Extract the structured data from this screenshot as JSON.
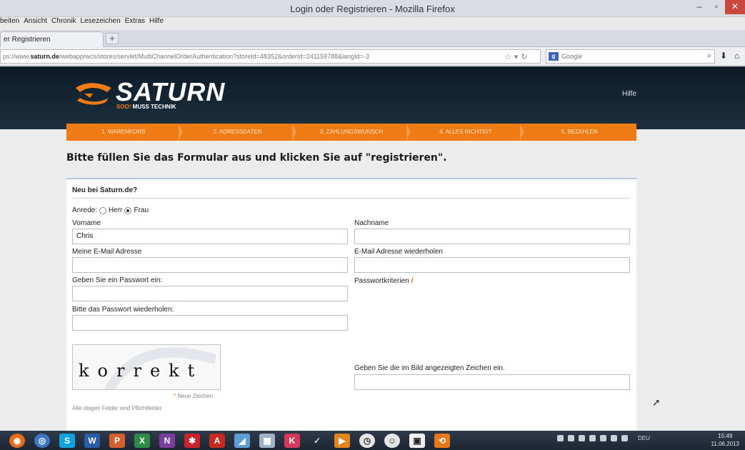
{
  "window": {
    "title": "Login oder Registrieren - Mozilla Firefox",
    "menu": [
      "beiten",
      "Ansicht",
      "Chronik",
      "Lesezeichen",
      "Extras",
      "Hilfe"
    ],
    "tab_label": "er Registrieren",
    "new_tab_symbol": "+"
  },
  "navbar": {
    "url_prefix": "ps://www.",
    "url_domain": "saturn.de",
    "url_rest": "/webapp/wcs/stores/servlet/MultiChannelOrderAuthentication?storeId=48352&orderId=241159788&langId=-3",
    "search_placeholder": "Google",
    "search_engine_icon": "g-icon"
  },
  "site": {
    "logo_text": "SATURN",
    "logo_tag_orange": "SOO!",
    "logo_tag_white": " MUSS TECHNIK",
    "help": "Hilfe",
    "steps": [
      "1. Warenkorb",
      "2. Adressdaten",
      "3. Zahlungswunsch",
      "4. Alles richtig?",
      "5. Bezahlen"
    ],
    "headline": "Bitte füllen Sie das Formular aus und klicken Sie auf \"registrieren\"."
  },
  "form": {
    "section_title": "Neu bei Saturn.de?",
    "salutation_label": "Anrede:",
    "salutation_options": [
      "Herr",
      "Frau"
    ],
    "salutation_selected": "Frau",
    "vorname_label": "Vorname",
    "vorname_value": "Chris",
    "nachname_label": "Nachname",
    "nachname_value": "",
    "email_label": "Meine E-Mail Adresse",
    "email_repeat_label": "E-Mail Adresse wiederholen",
    "password_label": "Geben Sie ein Passwort ein:",
    "password_criteria_label": "Passwortkriterien",
    "password_repeat_label": "Bitte das Passwort wiederholen:",
    "captcha_text": "korrekt",
    "captcha_instruction": "Geben Sie die im Bild angezeigten Zeichen ein.",
    "captcha_new": "Neue Zeichen",
    "required_note": "Alle obigen Felder sind Pflichtfelder."
  },
  "taskbar": {
    "tray_lang": "DEU",
    "clock_time": "15:49",
    "clock_date": "11.06.2013"
  },
  "colors": {
    "accent_orange": "#ee7b14",
    "header_dark": "#132230"
  }
}
